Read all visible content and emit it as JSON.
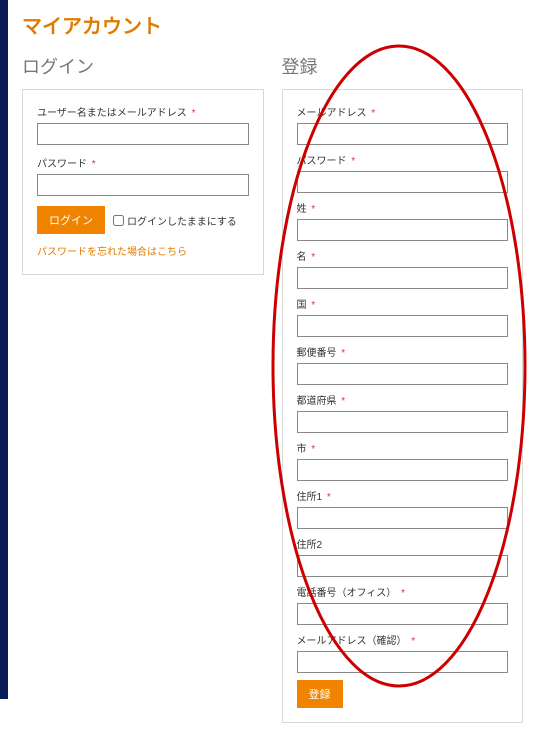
{
  "page_title": "マイアカウント",
  "login": {
    "heading": "ログイン",
    "username_label": "ユーザー名またはメールアドレス",
    "password_label": "パスワード",
    "button": "ログイン",
    "remember": "ログインしたままにする",
    "forgot": "パスワードを忘れた場合はこちら"
  },
  "register": {
    "heading": "登録",
    "email_label": "メールアドレス",
    "password_label": "パスワード",
    "lastname_label": "姓",
    "firstname_label": "名",
    "country_label": "国",
    "postalcode_label": "郵便番号",
    "prefecture_label": "都道府県",
    "city_label": "市",
    "address1_label": "住所1",
    "address2_label": "住所2",
    "phone_label": "電話番号（オフィス）",
    "email_confirm_label": "メールアドレス（確認）",
    "button": "登録"
  },
  "asterisk": "*",
  "annotation": {
    "type": "ellipse",
    "stroke": "#cc0000",
    "stroke_width": 3
  }
}
